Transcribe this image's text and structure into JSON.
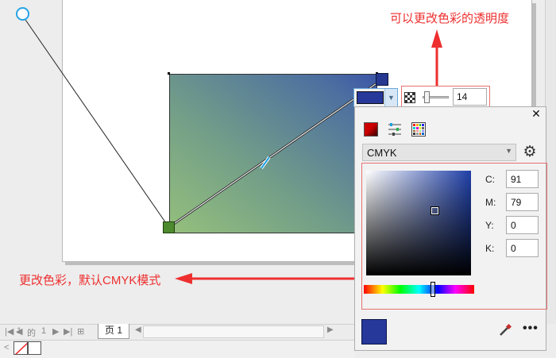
{
  "annotations": {
    "transparency_note": "可以更改色彩的透明度",
    "color_note": "更改色彩，默认CMYK模式"
  },
  "transparency": {
    "value": "14"
  },
  "color_panel": {
    "model": "CMYK",
    "close_glyph": "✕",
    "fields": [
      {
        "label": "C:",
        "value": "91"
      },
      {
        "label": "M:",
        "value": "79"
      },
      {
        "label": "Y:",
        "value": "0"
      },
      {
        "label": "K:",
        "value": "0"
      }
    ],
    "current_color": "#26389a"
  },
  "page_nav": {
    "current": "1",
    "of": "的",
    "total": "1",
    "tab_label": "页 1"
  },
  "colors": {
    "accent": "#ee2f2f",
    "gradient_start": "#4d8a2d",
    "gradient_end": "#26388f"
  },
  "icons": [
    "close-icon",
    "color-mixer-icon",
    "color-sliders-icon",
    "color-palette-icon",
    "gear-icon",
    "eyedropper-icon",
    "more-icon",
    "checkerboard-transparency-icon"
  ]
}
